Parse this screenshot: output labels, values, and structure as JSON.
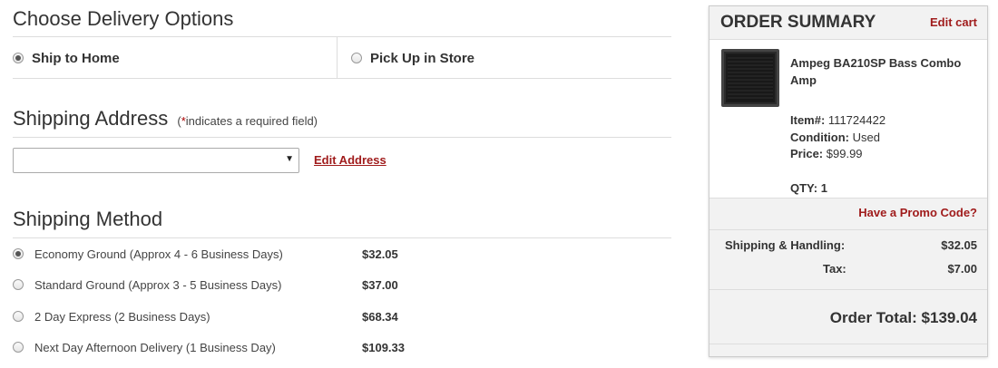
{
  "delivery": {
    "title": "Choose Delivery Options",
    "options": [
      {
        "label": "Ship to Home",
        "selected": true
      },
      {
        "label": "Pick Up in Store",
        "selected": false
      }
    ]
  },
  "address": {
    "title": "Shipping Address",
    "note_prefix": "(",
    "note_star": "*",
    "note_text": "indicates a required field)",
    "selected_value": "",
    "edit_label": "Edit Address"
  },
  "shipping": {
    "title": "Shipping Method",
    "methods": [
      {
        "label": "Economy Ground (Approx 4 - 6 Business Days)",
        "price": "$32.05",
        "selected": true
      },
      {
        "label": "Standard Ground (Approx 3 - 5 Business Days)",
        "price": "$37.00",
        "selected": false
      },
      {
        "label": "2 Day Express (2 Business Days)",
        "price": "$68.34",
        "selected": false
      },
      {
        "label": "Next Day Afternoon Delivery (1 Business Day)",
        "price": "$109.33",
        "selected": false
      }
    ]
  },
  "summary": {
    "title": "ORDER SUMMARY",
    "edit_cart": "Edit cart",
    "item": {
      "name": "Ampeg BA210SP Bass Combo Amp",
      "item_label": "Item#:",
      "item_number": "111724422",
      "condition_label": "Condition:",
      "condition": "Used",
      "price_label": "Price:",
      "price": "$99.99",
      "qty_label": "QTY:",
      "qty": "1"
    },
    "promo": "Have a Promo Code?",
    "shipping_label": "Shipping & Handling:",
    "shipping_value": "$32.05",
    "tax_label": "Tax:",
    "tax_value": "$7.00",
    "total_label": "Order Total:",
    "total_value": "$139.04"
  },
  "colors": {
    "accent": "#a01c1c",
    "panel_bg": "#f2f2f2",
    "rule": "#dddddd"
  }
}
